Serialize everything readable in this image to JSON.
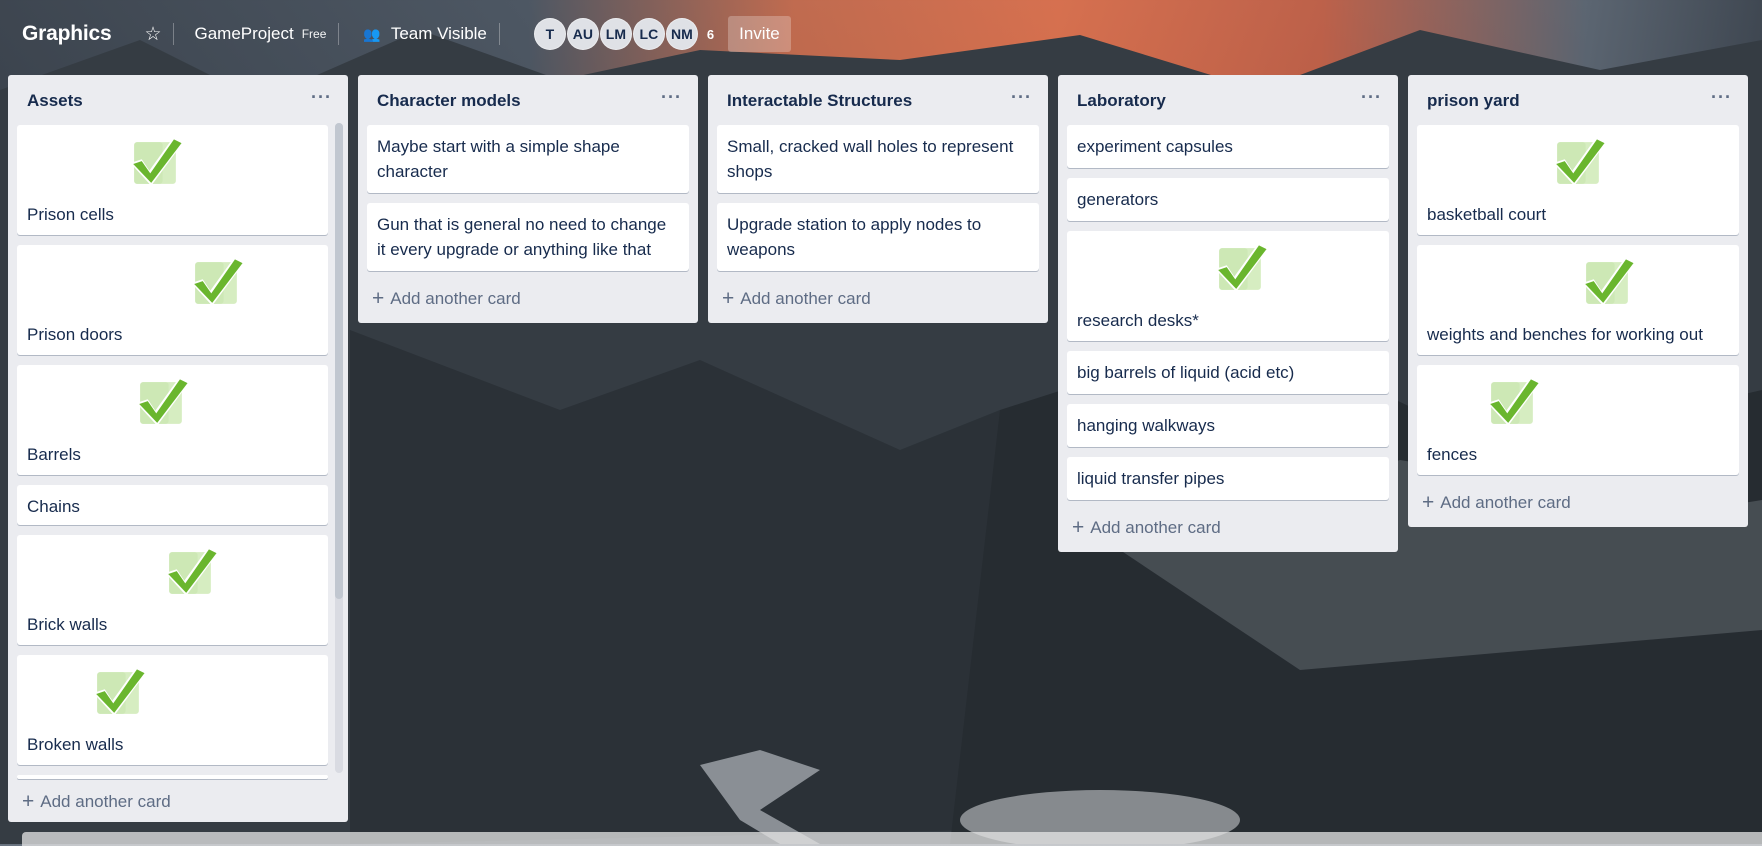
{
  "header": {
    "board_title": "Graphics",
    "star_icon": "star-icon",
    "team_name": "GameProject",
    "team_badge": "Free",
    "visibility_icon": "team-icon",
    "visibility_label": "Team Visible",
    "members": [
      "T",
      "AU",
      "LM",
      "LC",
      "NM"
    ],
    "member_count": "6",
    "invite_label": "Invite"
  },
  "lists": [
    {
      "title": "Assets",
      "cards": [
        "Prison cells",
        "Prison doors",
        "Barrels",
        "Chains",
        "Brick walls",
        "Broken walls"
      ],
      "add_label": "Add another card"
    },
    {
      "title": "Character models",
      "cards": [
        "Maybe start with a simple shape character",
        "Gun that is general no need to change it every upgrade or anything like that"
      ],
      "add_label": "Add another card"
    },
    {
      "title": "Interactable Structures",
      "cards": [
        "Small, cracked wall holes to represent shops",
        "Upgrade station to apply nodes to weapons"
      ],
      "add_label": "Add another card"
    },
    {
      "title": "Laboratory",
      "cards": [
        "experiment capsules",
        "generators",
        "research desks*",
        "big barrels of liquid (acid etc)",
        "hanging walkways",
        "liquid transfer pipes"
      ],
      "add_label": "Add another card"
    },
    {
      "title": "prison yard",
      "cards": [
        "basketball court",
        "weights and benches for working out",
        "fences"
      ],
      "add_label": "Add another card"
    }
  ],
  "colors": {
    "list_bg": "#ebecf0",
    "check_green": "#6ab62e",
    "text": "#172b4d"
  }
}
